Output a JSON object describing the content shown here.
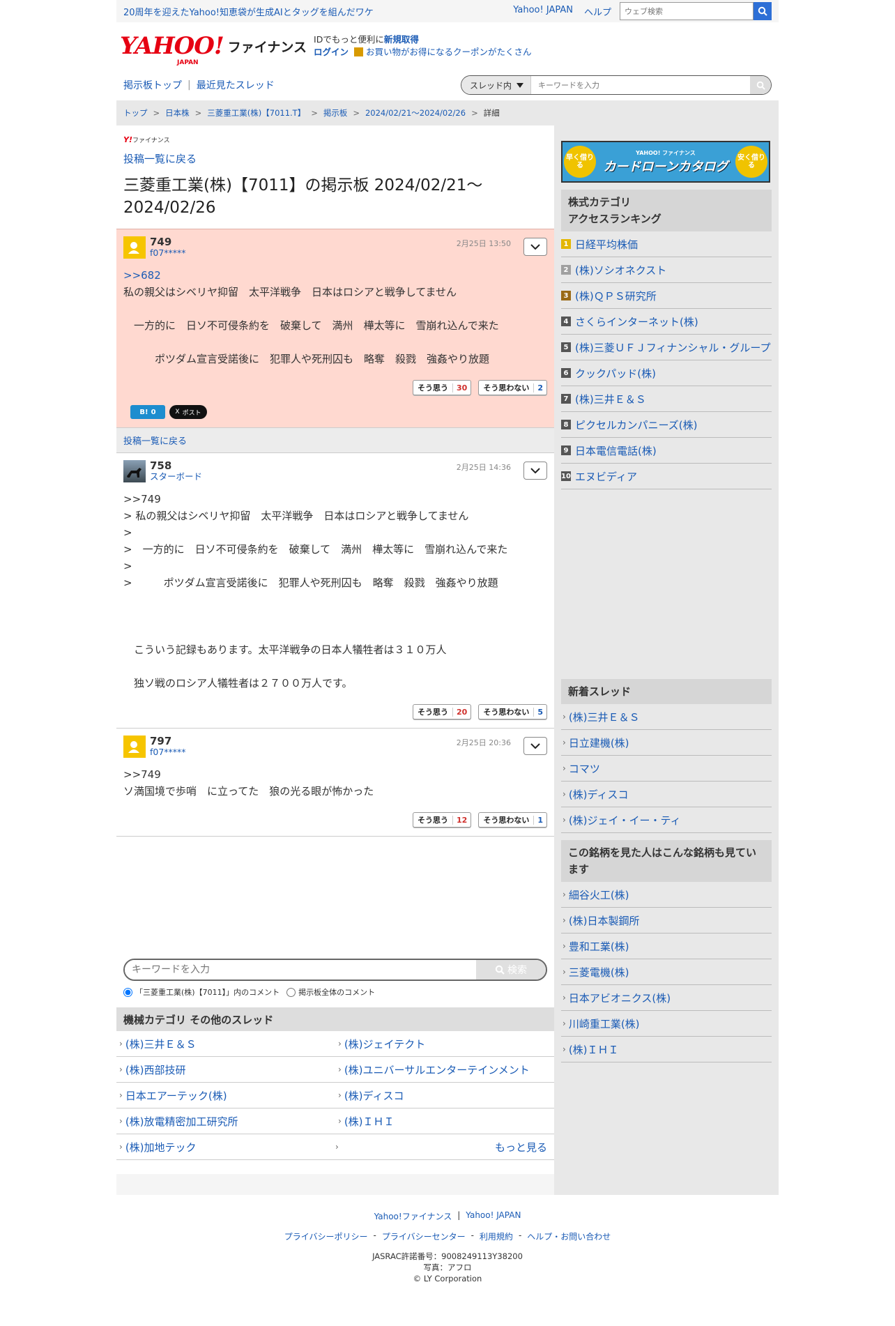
{
  "topbar": {
    "news": "20周年を迎えたYahoo!知恵袋が生成AIとタッグを組んだワケ",
    "links": [
      "Yahoo! JAPAN",
      "ヘルプ"
    ],
    "web_search_placeholder": "ウェブ検索"
  },
  "header": {
    "logo_main": "YAHOO!",
    "logo_sub": "JAPAN",
    "logo_fin": "ファイナンス",
    "line1_prefix": "IDでもっと便利に",
    "line1_link": "新規取得",
    "login": "ログイン",
    "coupon": "お買い物がお得になるクーポンがたくさん"
  },
  "subnav": {
    "board_top": "掲示板トップ",
    "sep": "|",
    "recent": "最近見たスレッド",
    "scope": "スレッド内",
    "keyword_placeholder": "キーワードを入力"
  },
  "breadcrumb": [
    "トップ",
    "日本株",
    "三菱重工業(株)【7011.T】",
    "掲示板",
    "2024/02/21〜2024/02/26",
    "詳細"
  ],
  "main": {
    "mini_logo_y": "Y!",
    "mini_logo_text": "ファイナンス",
    "back_link": "投稿一覧に戻る",
    "title": "三菱重工業(株)【7011】の掲示板 2024/02/21〜2024/02/26",
    "back_bar": "投稿一覧に戻る",
    "posts": [
      {
        "num": "749",
        "user": "f07*****",
        "date": "2月25日 13:50",
        "reply": ">>682",
        "lines": [
          "私の親父はシベリヤ抑留　太平洋戦争　日本はロシアと戦争してません",
          "",
          "　一方的に　日ソ不可侵条約を　破棄して　満州　樺太等に　雪崩れ込んで来た",
          "",
          "　　　ポツダム宣言受諾後に　犯罪人や死刑囚も　略奪　殺戮　強姦やり放題"
        ],
        "yes_label": "そう思う",
        "yes": "30",
        "no_label": "そう思わない",
        "no": "2"
      },
      {
        "num": "758",
        "user": "スターボード",
        "date": "2月25日 14:36",
        "reply": ">>749",
        "lines": [
          "> 私の親父はシベリヤ抑留　太平洋戦争　日本はロシアと戦争してません",
          ">",
          ">　一方的に　日ソ不可侵条約を　破棄して　満州　樺太等に　雪崩れ込んで来た",
          ">",
          ">　　　ポツダム宣言受諾後に　犯罪人や死刑囚も　略奪　殺戮　強姦やり放題",
          "",
          "",
          "",
          "　こういう記録もあります。太平洋戦争の日本人犠牲者は３１０万人",
          "",
          "　独ソ戦のロシア人犠牲者は２７００万人です。"
        ],
        "yes_label": "そう思う",
        "yes": "20",
        "no_label": "そう思わない",
        "no": "5"
      },
      {
        "num": "797",
        "user": "f07*****",
        "date": "2月25日 20:36",
        "reply": ">>749",
        "lines": [
          "ソ満国境で歩哨　に立ってた　狼の光る眼が怖かった"
        ],
        "yes_label": "そう思う",
        "yes": "12",
        "no_label": "そう思わない",
        "no": "1"
      }
    ],
    "share": {
      "hatena": "B!",
      "hatena_count": "0",
      "x": "X",
      "x_label": "ポスト"
    },
    "bottom_search": {
      "placeholder": "キーワードを入力",
      "button": "検索",
      "radio1": "「三菱重工業(株)【7011】」内のコメント",
      "radio2": "掲示板全体のコメント"
    },
    "other_threads_title": "機械カテゴリ  その他のスレッド",
    "other_threads": [
      "(株)三井Ｅ＆Ｓ",
      "(株)ジェイテクト",
      "(株)西部技研",
      "(株)ユニバーサルエンターテインメント",
      "日本エアーテック(株)",
      "(株)ディスコ",
      "(株)放電精密加工研究所",
      "(株)ＩＨＩ",
      "(株)加地テック"
    ],
    "more": "もっと見る"
  },
  "sidebar": {
    "ad": {
      "left": "早く借りる",
      "brand": "YAHOO! ファイナンス",
      "title": "カードローンカタログ",
      "right": "安く借りる"
    },
    "ranking_title_1": "株式カテゴリ",
    "ranking_title_2": "アクセスランキング",
    "ranking": [
      "日経平均株価",
      "(株)ソシオネクスト",
      "(株)ＱＰＳ研究所",
      "さくらインターネット(株)",
      "(株)三菱ＵＦＪフィナンシャル・グループ",
      "クックパッド(株)",
      "(株)三井Ｅ＆Ｓ",
      "ピクセルカンパニーズ(株)",
      "日本電信電話(株)",
      "エヌビディア"
    ],
    "new_title": "新着スレッド",
    "new_threads": [
      "(株)三井Ｅ＆Ｓ",
      "日立建機(株)",
      "コマツ",
      "(株)ディスコ",
      "(株)ジェイ・イー・ティ"
    ],
    "also_title": "この銘柄を見た人はこんな銘柄も見ています",
    "also": [
      "細谷火工(株)",
      "(株)日本製鋼所",
      "豊和工業(株)",
      "三菱電機(株)",
      "日本アビオニクス(株)",
      "川崎重工業(株)",
      "(株)ＩＨＩ"
    ]
  },
  "footer": {
    "links1": [
      "Yahoo!ファイナンス",
      "Yahoo! JAPAN"
    ],
    "sep": "|",
    "links2": [
      "プライバシーポリシー",
      "プライバシーセンター",
      "利用規約",
      "ヘルプ・お問い合わせ"
    ],
    "dash": "-",
    "jasrac": "JASRAC許諾番号：9008249113Y38200",
    "photo": "写真：アフロ",
    "copyright": "© LY Corporation"
  }
}
